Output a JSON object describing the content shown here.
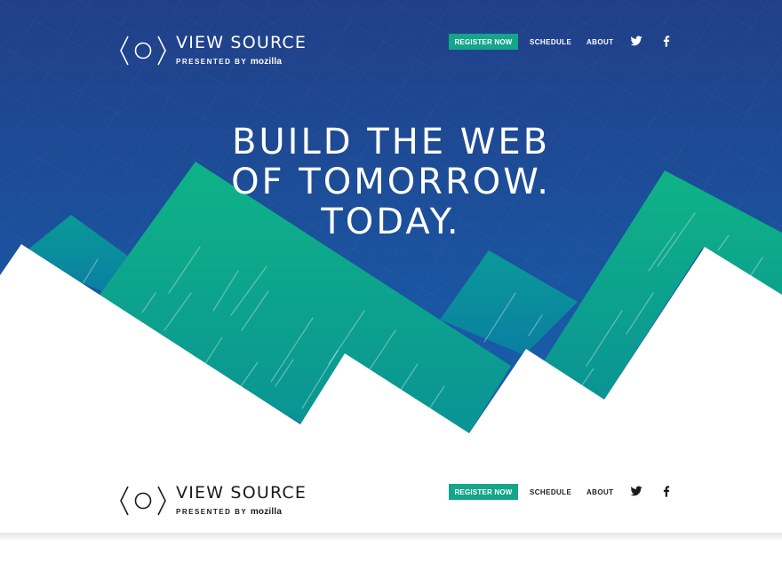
{
  "header": {
    "logo_title": "VIEW SOURCE",
    "logo_presented": "PRESENTED BY",
    "logo_brand": "mozilla",
    "nav": {
      "register": "REGISTER NOW",
      "schedule": "SCHEDULE",
      "about": "ABOUT"
    },
    "social": [
      "twitter-icon",
      "facebook-icon"
    ]
  },
  "hero": {
    "headline_lines": [
      "BUILD THE WEB",
      "OF TOMORROW.",
      "TODAY."
    ]
  },
  "sticky_header": {
    "logo_title": "VIEW SOURCE",
    "logo_presented": "PRESENTED BY",
    "logo_brand": "mozilla",
    "nav": {
      "register": "REGISTER NOW",
      "schedule": "SCHEDULE",
      "about": "ABOUT"
    }
  },
  "colors": {
    "hero_top": "#1f3f8a",
    "hero_bottom": "#1a5aa8",
    "mountain_green": "#0fae88",
    "mountain_teal": "#0b8f96",
    "button_green": "#14a58a"
  }
}
